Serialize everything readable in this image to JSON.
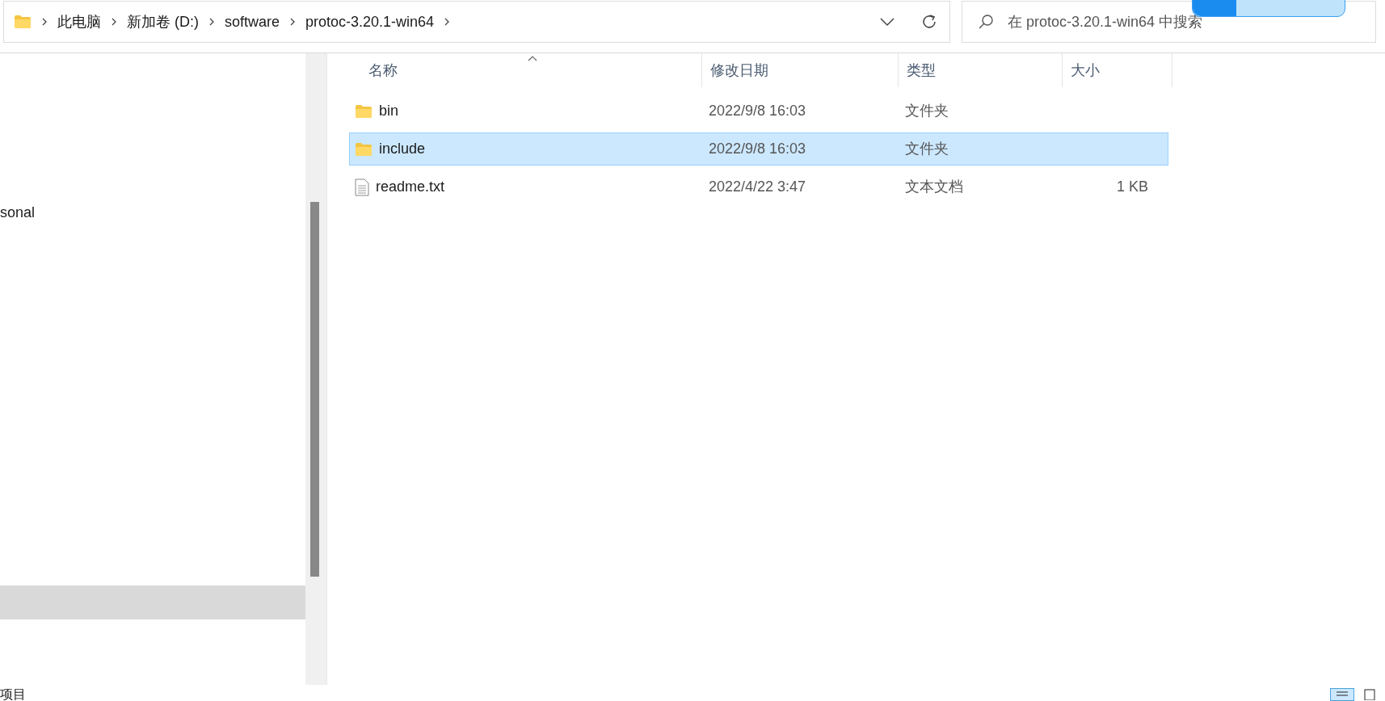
{
  "address_bar": {
    "crumbs": [
      "此电脑",
      "新加卷 (D:)",
      "software",
      "protoc-3.20.1-win64"
    ]
  },
  "search": {
    "placeholder": "在 protoc-3.20.1-win64 中搜索"
  },
  "sidebar": {
    "items": [
      {
        "label": "sonal",
        "selected": false
      },
      {
        "kind": "blank",
        "selected": true
      }
    ]
  },
  "table": {
    "columns": [
      "名称",
      "修改日期",
      "类型",
      "大小"
    ],
    "rows": [
      {
        "kind": "folder",
        "name": "bin",
        "modified": "2022/9/8 16:03",
        "type": "文件夹",
        "selected": false
      },
      {
        "kind": "folder",
        "name": "include",
        "modified": "2022/9/8 16:03",
        "type": "文件夹",
        "selected": true
      },
      {
        "kind": "file",
        "name": "readme.txt",
        "modified": "2022/4/22 3:47",
        "type": "文本文档",
        "size": "1 KB",
        "selected": false
      }
    ]
  },
  "status_bar": {
    "text": "项目",
    "views": [
      {
        "kind": "details",
        "selected": true
      },
      {
        "kind": "tiles",
        "selected": false
      }
    ]
  }
}
